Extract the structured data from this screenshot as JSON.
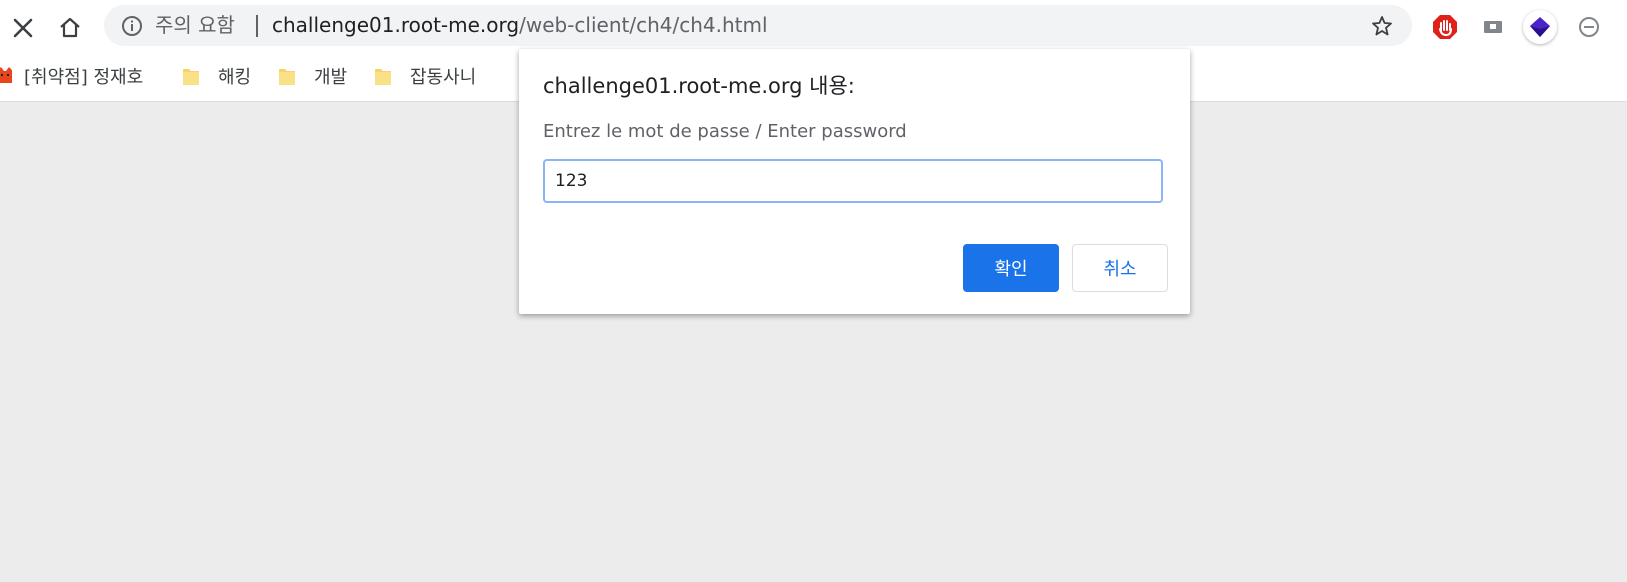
{
  "toolbar": {
    "security_label": "주의 요함",
    "url_host": "challenge01.root-me.org",
    "url_path": "/web-client/ch4/ch4.html"
  },
  "bookmarks": [
    {
      "label": "[취약점] 정재호",
      "icon": "favicon-icon"
    },
    {
      "label": "해킹",
      "icon": "folder-icon"
    },
    {
      "label": "개발",
      "icon": "folder-icon"
    },
    {
      "label": "잡동사니",
      "icon": "folder-icon"
    }
  ],
  "dialog": {
    "title": "challenge01.root-me.org 내용:",
    "message": "Entrez le mot de passe / Enter password",
    "input_value": "123",
    "ok_label": "확인",
    "cancel_label": "취소"
  },
  "colors": {
    "accent": "#1a73e8",
    "content_bg": "#ececec",
    "omnibox_bg": "#f1f3f4"
  }
}
